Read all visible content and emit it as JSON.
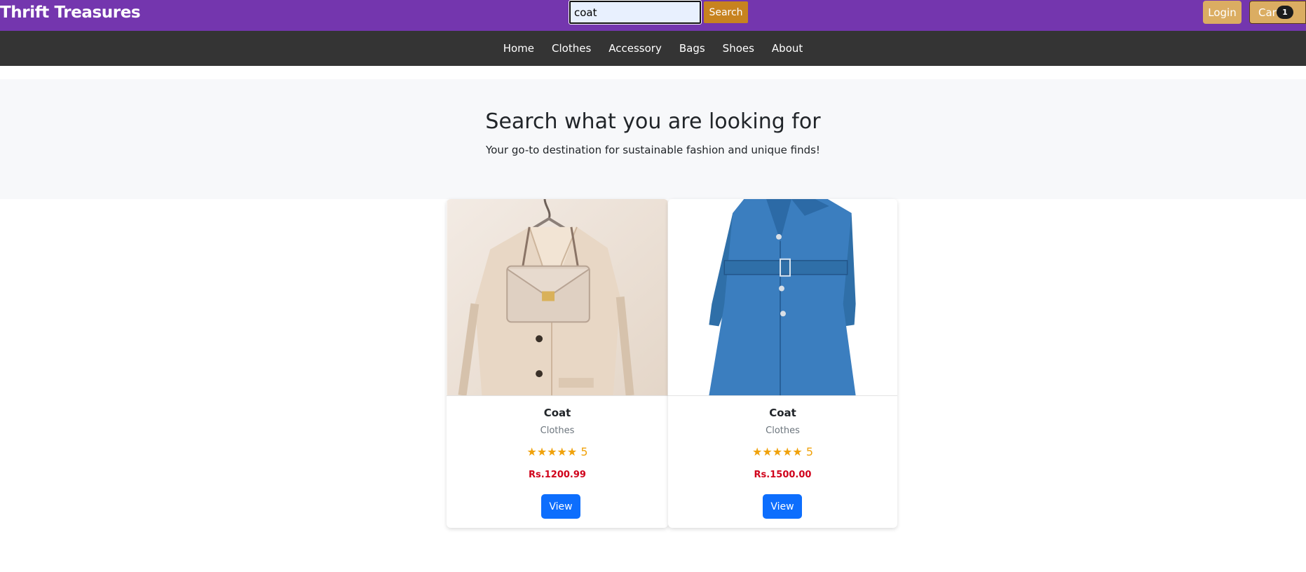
{
  "header": {
    "brand": "Thrift Treasures",
    "search_value": "coat",
    "search_button": "Search",
    "login_button": "Login",
    "cart_button": "Cart",
    "cart_count": "1"
  },
  "nav": {
    "items": [
      "Home",
      "Clothes",
      "Accessory",
      "Bags",
      "Shoes",
      "About"
    ]
  },
  "hero": {
    "title": "Search what you are looking for",
    "subtitle": "Your go-to destination for sustainable fashion and unique finds!"
  },
  "products": [
    {
      "name": "Coat",
      "category": "Clothes",
      "stars": "★★★★★",
      "rating": "5",
      "price": "Rs.1200.99",
      "button": "View",
      "image": "cream-coat-with-handbag"
    },
    {
      "name": "Coat",
      "category": "Clothes",
      "stars": "★★★★★",
      "rating": "5",
      "price": "Rs.1500.00",
      "button": "View",
      "image": "blue-belted-coat"
    }
  ],
  "colors": {
    "topbar": "#7436ae",
    "navbar": "#343434",
    "search_button": "#c7831f",
    "header_buttons": "#dbad62",
    "star": "#f0a20c",
    "price": "#d0021b",
    "view_button": "#0d6efd"
  }
}
